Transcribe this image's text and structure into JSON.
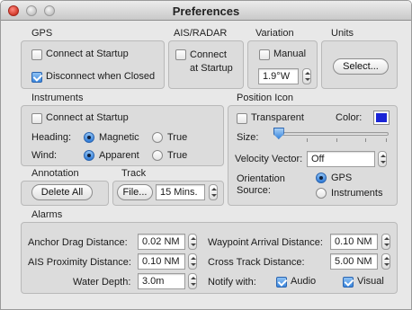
{
  "window": {
    "title": "Preferences"
  },
  "gps": {
    "label": "GPS",
    "connect_startup": "Connect at Startup",
    "disconnect_closed": "Disconnect when Closed"
  },
  "ais": {
    "label": "AIS/RADAR",
    "connect_line1": "Connect",
    "connect_line2": "at Startup"
  },
  "variation": {
    "label": "Variation",
    "manual": "Manual",
    "value": "1.9°W"
  },
  "units": {
    "label": "Units",
    "select_button": "Select..."
  },
  "instruments": {
    "label": "Instruments",
    "connect_startup": "Connect at Startup",
    "heading_label": "Heading:",
    "heading_options": [
      "Magnetic",
      "True"
    ],
    "wind_label": "Wind:",
    "wind_options": [
      "Apparent",
      "True"
    ]
  },
  "position_icon": {
    "label": "Position Icon",
    "transparent": "Transparent",
    "color_label": "Color:",
    "color_value": "#1a24d6",
    "size_label": "Size:",
    "size_level": 0.03,
    "velocity_label": "Velocity Vector:",
    "velocity_value": "Off",
    "orientation_label_1": "Orientation",
    "orientation_label_2": "Source:",
    "orientation_options": [
      "GPS",
      "Instruments"
    ]
  },
  "annotation": {
    "label": "Annotation",
    "delete_all": "Delete All"
  },
  "track": {
    "label": "Track",
    "file_button": "File...",
    "interval": "15 Mins."
  },
  "alarms": {
    "label": "Alarms",
    "anchor_label": "Anchor Drag Distance:",
    "anchor_value": "0.02 NM",
    "ais_label": "AIS Proximity Distance:",
    "ais_value": "0.10 NM",
    "depth_label": "Water Depth:",
    "depth_value": "3.0m",
    "waypoint_label": "Waypoint Arrival Distance:",
    "waypoint_value": "0.10 NM",
    "xtrack_label": "Cross Track Distance:",
    "xtrack_value": "5.00 NM",
    "notify_label": "Notify with:",
    "audio": "Audio",
    "visual": "Visual"
  }
}
